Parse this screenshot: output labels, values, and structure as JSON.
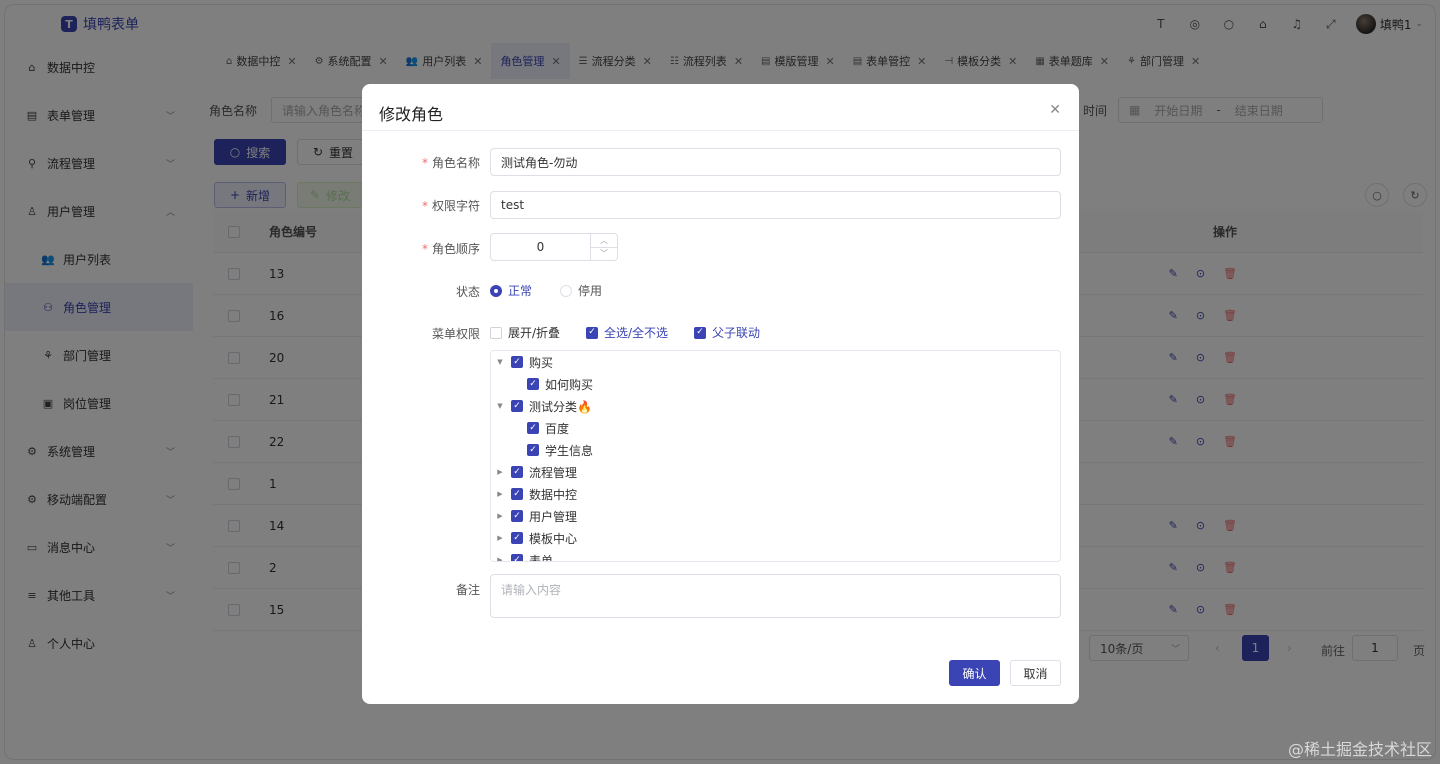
{
  "app": {
    "logo_letter": "T",
    "title": "填鸭表单",
    "user": "填鸭1"
  },
  "topbar_icons": [
    "text-size-icon",
    "github-icon",
    "search-icon",
    "shirt-icon",
    "bell-icon",
    "fullscreen-icon"
  ],
  "sidebar": {
    "items": [
      {
        "label": "数据中控",
        "icon": "home-icon"
      },
      {
        "label": "表单管理",
        "icon": "form-icon"
      },
      {
        "label": "流程管理",
        "icon": "flow-icon"
      },
      {
        "label": "用户管理",
        "icon": "user-icon"
      },
      {
        "label": "用户列表",
        "icon": "users-icon"
      },
      {
        "label": "角色管理",
        "icon": "role-icon"
      },
      {
        "label": "部门管理",
        "icon": "dept-icon"
      },
      {
        "label": "岗位管理",
        "icon": "post-icon"
      },
      {
        "label": "系统管理",
        "icon": "gear-icon"
      },
      {
        "label": "移动端配置",
        "icon": "mobile-gear-icon"
      },
      {
        "label": "消息中心",
        "icon": "message-icon"
      },
      {
        "label": "其他工具",
        "icon": "tools-icon"
      },
      {
        "label": "个人中心",
        "icon": "person-icon"
      }
    ]
  },
  "tabs": [
    {
      "label": "数据中控"
    },
    {
      "label": "系统配置"
    },
    {
      "label": "用户列表"
    },
    {
      "label": "角色管理"
    },
    {
      "label": "流程分类"
    },
    {
      "label": "流程列表"
    },
    {
      "label": "模版管理"
    },
    {
      "label": "表单管控"
    },
    {
      "label": "模板分类"
    },
    {
      "label": "表单题库"
    },
    {
      "label": "部门管理"
    }
  ],
  "filter": {
    "role_name_label": "角色名称",
    "role_name_placeholder": "请输入角色名称",
    "time_label": "时间",
    "start_placeholder": "开始日期",
    "dash": "-",
    "end_placeholder": "结束日期",
    "search_btn": "搜索",
    "reset_btn": "重置"
  },
  "toolbar": {
    "add_btn": "新增",
    "edit_btn": "修改"
  },
  "table": {
    "col_role_id": "角色编号",
    "col_ops": "操作",
    "rows": [
      "13",
      "16",
      "20",
      "21",
      "22",
      "1",
      "14",
      "2",
      "15"
    ]
  },
  "pagination": {
    "page_size": "10条/页",
    "current_page": "1",
    "goto_label": "前往",
    "goto_value": "1",
    "page_unit": "页"
  },
  "dialog": {
    "title": "修改角色",
    "role_name_label": "角色名称",
    "role_name_value": "测试角色-勿动",
    "perm_label": "权限字符",
    "perm_value": "test",
    "order_label": "角色顺序",
    "order_value": "0",
    "status_label": "状态",
    "status_normal": "正常",
    "status_disabled": "停用",
    "menu_label": "菜单权限",
    "expand_label": "展开/折叠",
    "select_all_label": "全选/全不选",
    "linkage_label": "父子联动",
    "tree": [
      {
        "label": "购买",
        "level": 0,
        "expanded": true
      },
      {
        "label": "如何购买",
        "level": 1
      },
      {
        "label": "测试分类🔥",
        "level": 0,
        "expanded": true
      },
      {
        "label": "百度",
        "level": 1
      },
      {
        "label": "学生信息",
        "level": 1
      },
      {
        "label": "流程管理",
        "level": 0,
        "expanded": false
      },
      {
        "label": "数据中控",
        "level": 0,
        "expanded": false
      },
      {
        "label": "用户管理",
        "level": 0,
        "expanded": false
      },
      {
        "label": "模板中心",
        "level": 0,
        "expanded": false
      },
      {
        "label": "表单",
        "level": 0,
        "expanded": false
      }
    ],
    "remark_label": "备注",
    "remark_placeholder": "请输入内容",
    "confirm_btn": "确认",
    "cancel_btn": "取消"
  },
  "watermark": "@稀土掘金技术社区",
  "colors": {
    "primary": "#3a44b4",
    "danger": "#f56c6c",
    "overlay": "rgba(0,0,0,0.5)"
  }
}
